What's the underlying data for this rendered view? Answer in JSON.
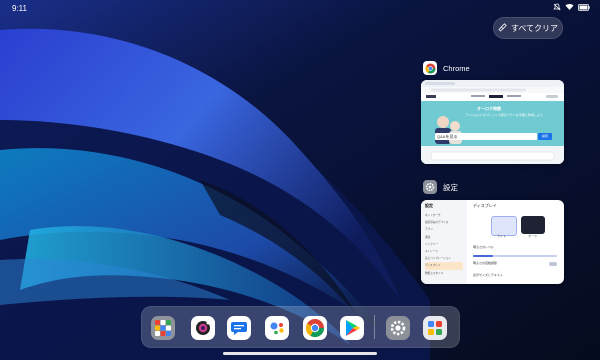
{
  "status_bar": {
    "time": "9:11"
  },
  "clear_all": {
    "label": "すべてクリア"
  },
  "recents": [
    {
      "app_name": "Chrome",
      "preview": {
        "hero_title": "オーロラ物語",
        "hero_text": "アンドロイドタブレットで旅のプランを手軽に作成しよう",
        "search_placeholder": "Q&Aを見る",
        "search_button": "検索"
      }
    },
    {
      "app_name": "設定",
      "preview": {
        "sidebar_title": "設定",
        "panel_title": "ディスプレイ",
        "menu": [
          "ネットワーク",
          "接続済みのデバイス",
          "アプリ",
          "通知",
          "バッテリー",
          "ストレージ",
          "音とバイブレーション",
          "ディスプレイ",
          "壁紙とスタイル"
        ],
        "theme_light": "ライト",
        "theme_dark": "ダーク",
        "brightness_label": "明るさのレベル",
        "adaptive_label": "明るさの自動調節",
        "font_label": "表示サイズとテキスト"
      }
    }
  ],
  "dock": {
    "apps": [
      {
        "name": "app-drawer",
        "color": "#8e939c"
      },
      {
        "name": "camera",
        "color": "#ffffff"
      },
      {
        "name": "messages",
        "color": "#ffffff"
      },
      {
        "name": "assistant",
        "color": "#ffffff"
      },
      {
        "name": "chrome",
        "color": "#ffffff"
      },
      {
        "name": "play-store",
        "color": "#ffffff"
      },
      {
        "name": "settings",
        "color": "#8a8f98"
      },
      {
        "name": "app-folder",
        "color": "#e9eaee"
      }
    ]
  },
  "colors": {
    "accent": "#1a73e8",
    "wallpaper_base": "#071026"
  }
}
